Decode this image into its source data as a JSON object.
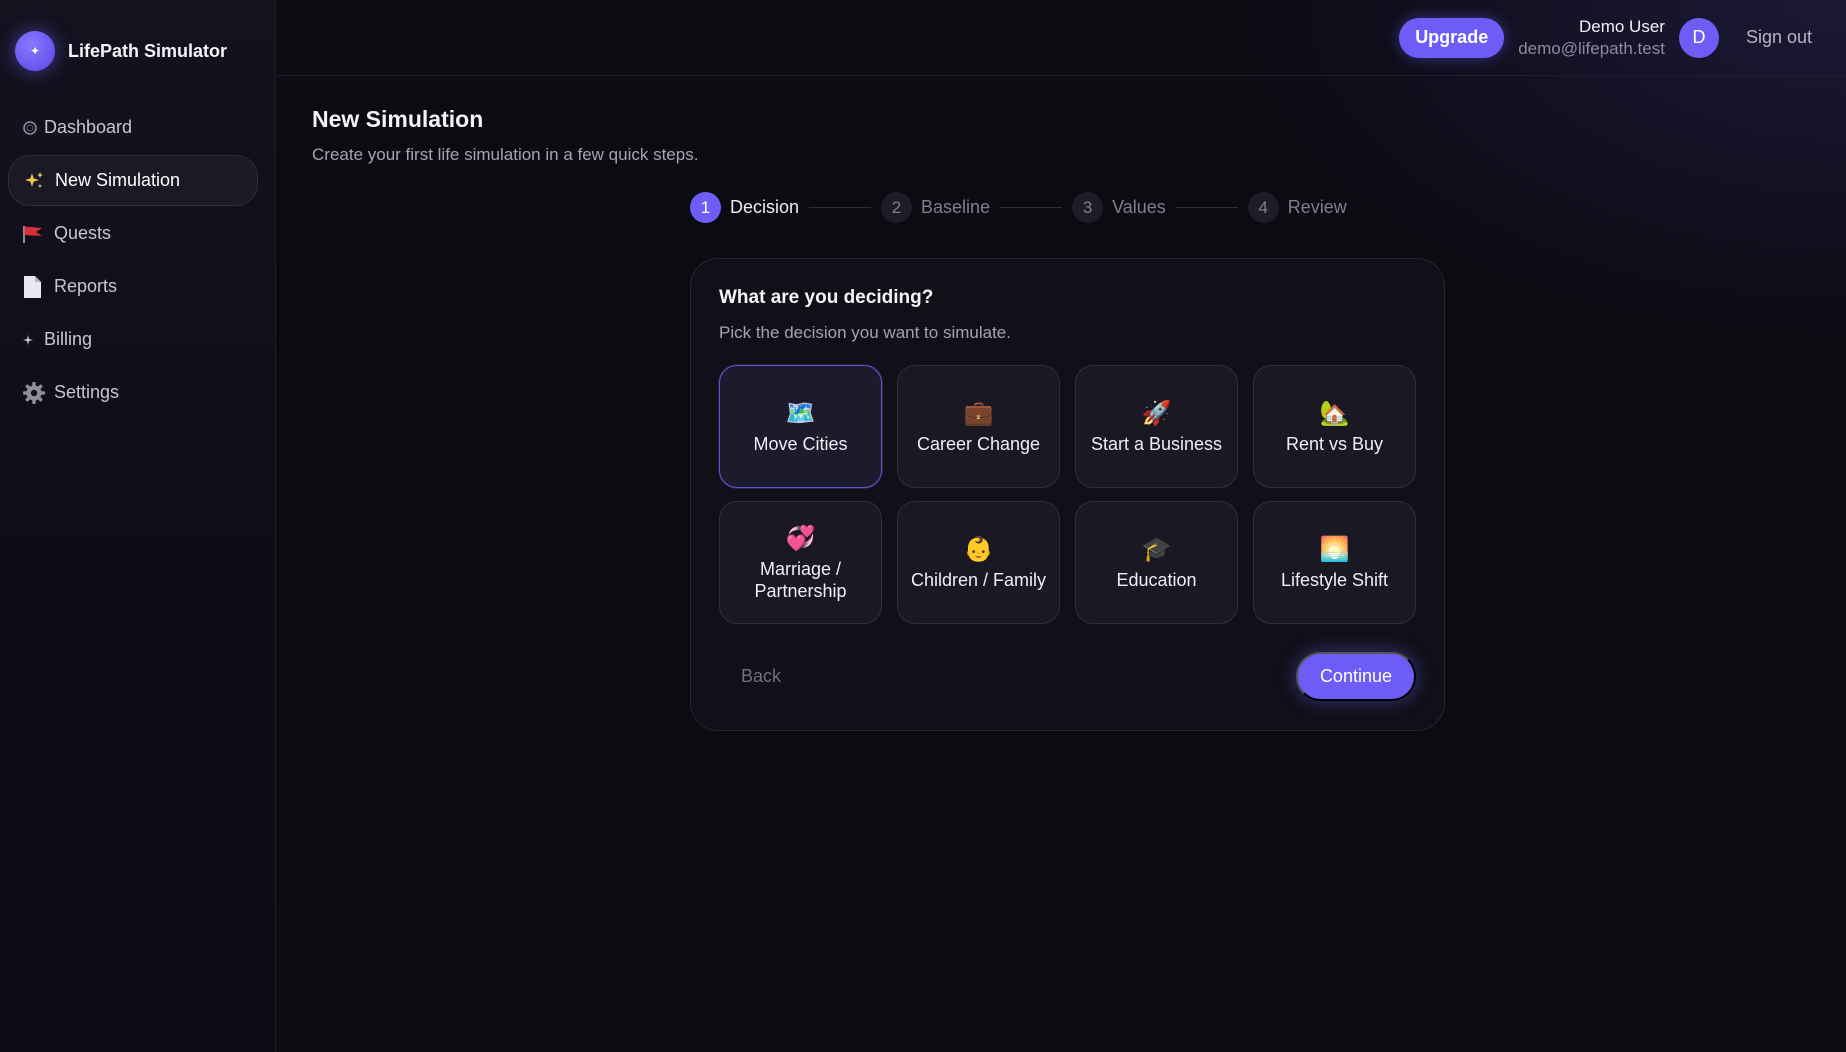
{
  "brand": {
    "name": "LifePath Simulator",
    "logo_glyph": "✦"
  },
  "sidebar": {
    "items": [
      {
        "label": "Dashboard",
        "icon": "circle-icon"
      },
      {
        "label": "New Simulation",
        "icon": "sparkles-icon",
        "active": true
      },
      {
        "label": "Quests",
        "icon": "flag-icon"
      },
      {
        "label": "Reports",
        "icon": "document-icon"
      },
      {
        "label": "Billing",
        "icon": "sparkle-icon"
      },
      {
        "label": "Settings",
        "icon": "gear-icon"
      }
    ]
  },
  "topbar": {
    "upgrade_label": "Upgrade",
    "user_name": "Demo User",
    "user_email": "demo@lifepath.test",
    "avatar_initial": "D",
    "signout_label": "Sign out"
  },
  "page": {
    "title": "New Simulation",
    "subtitle": "Create your first life simulation in a few quick steps."
  },
  "stepper": {
    "steps": [
      {
        "number": "1",
        "label": "Decision",
        "active": true
      },
      {
        "number": "2",
        "label": "Baseline"
      },
      {
        "number": "3",
        "label": "Values"
      },
      {
        "number": "4",
        "label": "Review"
      }
    ]
  },
  "card": {
    "title": "What are you deciding?",
    "subtitle": "Pick the decision you want to simulate.",
    "options": [
      {
        "emoji": "🗺️",
        "icon": "map-icon",
        "label": "Move Cities",
        "selected": true
      },
      {
        "emoji": "💼",
        "icon": "briefcase-icon",
        "label": "Career Change"
      },
      {
        "emoji": "🚀",
        "icon": "rocket-icon",
        "label": "Start a Business"
      },
      {
        "emoji": "🏡",
        "icon": "house-icon",
        "label": "Rent vs Buy"
      },
      {
        "emoji": "💞",
        "icon": "hearts-icon",
        "label": "Marriage / Partnership"
      },
      {
        "emoji": "👶",
        "icon": "baby-icon",
        "label": "Children / Family"
      },
      {
        "emoji": "🎓",
        "icon": "graduation-cap-icon",
        "label": "Education"
      },
      {
        "emoji": "🌅",
        "icon": "sunrise-icon",
        "label": "Lifestyle Shift"
      }
    ],
    "back_label": "Back",
    "continue_label": "Continue"
  },
  "colors": {
    "accent": "#6d5cf6",
    "background": "#0b0b12",
    "card": "#111019",
    "option": "#1a1923"
  }
}
